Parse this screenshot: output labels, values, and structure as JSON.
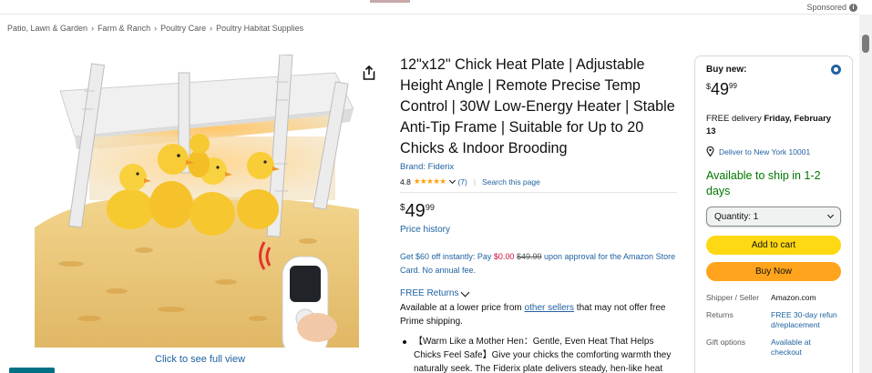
{
  "header": {
    "sponsored_label": "Sponsored"
  },
  "breadcrumb": [
    "Patio, Lawn & Garden",
    "Farm & Ranch",
    "Poultry Care",
    "Poultry Habitat Supplies"
  ],
  "gallery": {
    "see_full_label": "Click to see full view"
  },
  "product": {
    "title": "12\"x12\" Chick Heat Plate | Adjustable Height Angle | Remote Precise Temp Control | 30W Low-Energy Heater | Stable Anti-Tip Frame | Suitable for Up to 20 Chicks & Indoor Brooding",
    "brand": "Brand: Fiderix",
    "rating": "4.8",
    "stars": "★★★★★",
    "review_count": "(7)",
    "search_page": "Search this page",
    "price": {
      "currency": "$",
      "whole": "49",
      "fraction": "99"
    },
    "price_history": "Price history",
    "promo": {
      "text_a": "Get $60 off instantly: Pay ",
      "new_price": "$0.00",
      "old_price": "$49.99",
      "text_b": " upon approval for the Amazon Store Card. No annual fee."
    },
    "free_returns": "FREE Returns",
    "lower_price": {
      "text_a": "Available at a lower price from ",
      "link": "other sellers",
      "text_b": " that may not offer free Prime shipping."
    },
    "bullet": "【Warm Like a Mother Hen：Gentle, Even Heat That Helps Chicks Feel Safe】Give your chicks the comforting warmth they naturally seek. The Fiderix plate delivers steady, hen-like heat that helps little ones settle quickly and feel secure. Unlike heat"
  },
  "buybox": {
    "buy_new": "Buy new:",
    "price": {
      "currency": "$",
      "whole": "49",
      "fraction": "99"
    },
    "delivery_a": "FREE delivery ",
    "delivery_date": "Friday, February 13",
    "deliver_to": "Deliver to New York 10001",
    "availability": "Available to ship in 1-2 days",
    "quantity": "Quantity: 1",
    "add_to_cart": "Add to cart",
    "buy_now": "Buy Now",
    "info": [
      {
        "key": "Shipper / Seller",
        "value": "Amazon.com"
      },
      {
        "key": "Returns",
        "value": "FREE 30-day refund/replacement"
      },
      {
        "key": "Gift options",
        "value": "Available at checkout"
      }
    ]
  },
  "colors": {
    "link": "#2162a1",
    "add_to_cart": "#ffd814",
    "buy_now": "#ffa41c",
    "available": "#007600",
    "star": "#ff9f00"
  }
}
